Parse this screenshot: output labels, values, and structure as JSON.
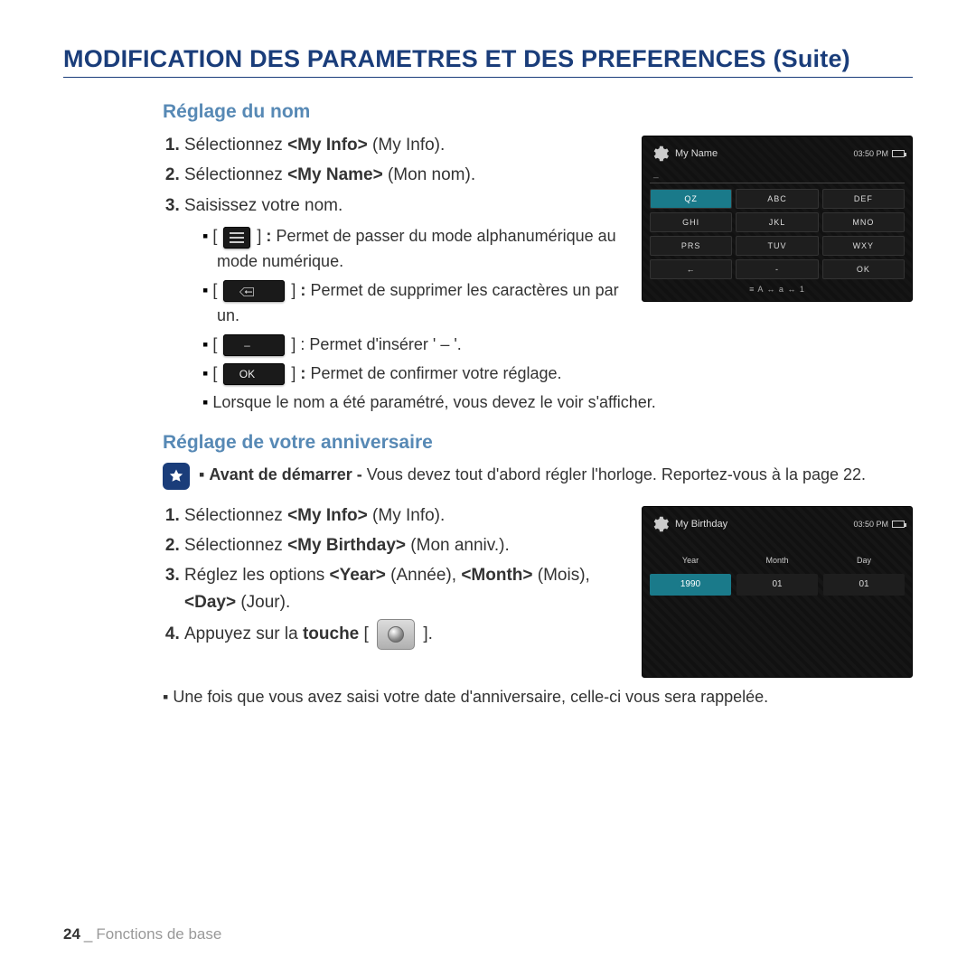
{
  "page_title": "MODIFICATION DES PARAMETRES ET DES PREFERENCES (Suite)",
  "section1": {
    "heading": "Réglage du nom",
    "step1_prefix": "Sélectionnez ",
    "step1_bold": "<My Info>",
    "step1_suffix": " (My Info).",
    "step2_prefix": "Sélectionnez ",
    "step2_bold": "<My Name>",
    "step2_suffix": " (Mon nom).",
    "step3": "Saisissez votre nom.",
    "sub_mode_suffix": "Permet de passer du mode alphanumérique au mode numérique.",
    "sub_del_suffix": "Permet de supprimer les caractères un par un.",
    "sub_dash_suffix": "Permet d'insérer ' – '.",
    "sub_ok_label": "OK",
    "sub_ok_suffix": "Permet de confirmer votre réglage.",
    "sub_final": "Lorsque le nom a été paramétré, vous devez le voir s'afficher."
  },
  "section2": {
    "heading": "Réglage de votre anniversaire",
    "tip_bold": "Avant de démarrer - ",
    "tip_rest": "Vous devez tout d'abord régler l'horloge. Reportez-vous à la page 22.",
    "step1_prefix": "Sélectionnez ",
    "step1_bold": "<My Info>",
    "step1_suffix": " (My Info).",
    "step2_prefix": "Sélectionnez ",
    "step2_bold": "<My Birthday>",
    "step2_suffix": " (Mon anniv.).",
    "step3_prefix": "Réglez les options ",
    "step3_b1": "<Year>",
    "step3_m1": " (Année), ",
    "step3_b2": "<Month>",
    "step3_m2": " (Mois), ",
    "step3_b3": "<Day>",
    "step3_m3": " (Jour).",
    "step4_prefix": "Appuyez sur la ",
    "step4_bold": "touche",
    "step4_open": " [ ",
    "step4_close": " ].",
    "note": "Une fois que vous avez saisi votre date d'anniversaire, celle-ci vous sera rappelée."
  },
  "device_name": {
    "title": "My Name",
    "time": "03:50 PM",
    "input_placeholder": "_",
    "keys": [
      "QZ",
      "ABC",
      "DEF",
      "GHI",
      "JKL",
      "MNO",
      "PRS",
      "TUV",
      "WXY",
      "←",
      "-",
      "OK"
    ],
    "selected_index": 0,
    "footer": "≡  A ↔ a  ↔ 1"
  },
  "device_bday": {
    "title": "My Birthday",
    "time": "03:50 PM",
    "cols": [
      {
        "label": "Year",
        "value": "1990",
        "selected": true
      },
      {
        "label": "Month",
        "value": "01",
        "selected": false
      },
      {
        "label": "Day",
        "value": "01",
        "selected": false
      }
    ]
  },
  "footer": {
    "page_number": "24",
    "section": "Fonctions de base"
  }
}
